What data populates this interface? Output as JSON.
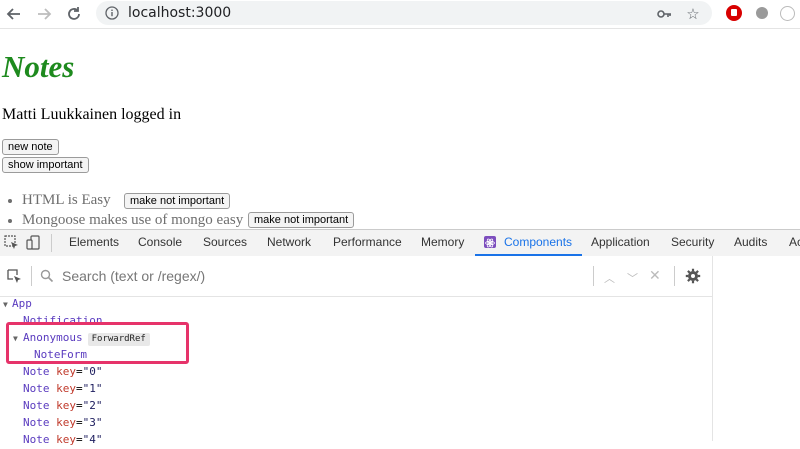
{
  "browser": {
    "url": "localhost:3000",
    "icons": [
      "back-arrow-icon",
      "forward-arrow-icon",
      "reload-icon",
      "key-icon",
      "star-icon"
    ]
  },
  "page": {
    "title": "Notes",
    "logged_in": "Matti Luukkainen logged in",
    "new_note_button": "new note",
    "show_important_button": "show important",
    "notes": [
      {
        "content": "HTML is Easy",
        "button": "make not important"
      },
      {
        "content": "Mongoose makes use of mongo easy",
        "button": "make not important"
      }
    ]
  },
  "devtools": {
    "tabs": [
      "Elements",
      "Console",
      "Sources",
      "Network",
      "Performance",
      "Memory",
      "Components",
      "Application",
      "Security",
      "Audits",
      "Ac"
    ],
    "active_tab": "Components",
    "search_placeholder": "Search (text or /regex/)",
    "tree": {
      "app": "App",
      "notification": "Notification",
      "anonymous": "Anonymous",
      "forwardref_badge": "ForwardRef",
      "noteform": "NoteForm",
      "note_label": "Note",
      "key_attr": "key",
      "note_keys": [
        "\"0\"",
        "\"1\"",
        "\"2\"",
        "\"3\"",
        "\"4\""
      ]
    }
  },
  "colors": {
    "title_green": "#1e8a1e",
    "active_tab_blue": "#1a73e8",
    "component_purple": "#5a3bbf",
    "key_red": "#c0392b",
    "highlight_pink": "#e6336a"
  }
}
